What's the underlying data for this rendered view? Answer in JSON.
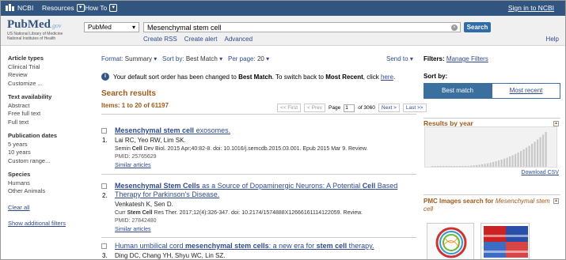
{
  "topbar": {
    "ncbi": "NCBI",
    "resources": "Resources",
    "howto": "How To",
    "signin": "Sign in to NCBI"
  },
  "logo": {
    "text": "PubMed",
    "suffix": ".gov",
    "sub1": "US National Library of Medicine",
    "sub2": "National Institutes of Health"
  },
  "search": {
    "db": "PubMed",
    "query": "Mesenchymal stem cell",
    "button": "Search",
    "links": [
      "Create RSS",
      "Create alert",
      "Advanced"
    ],
    "help": "Help"
  },
  "sidebar": {
    "groups": [
      {
        "title": "Article types",
        "items": [
          "Clinical Trial",
          "Review",
          "Customize ..."
        ]
      },
      {
        "title": "Text availability",
        "items": [
          "Abstract",
          "Free full text",
          "Full text"
        ]
      },
      {
        "title": "Publication dates",
        "items": [
          "5 years",
          "10 years",
          "Custom range..."
        ]
      },
      {
        "title": "Species",
        "items": [
          "Humans",
          "Other Animals"
        ]
      }
    ],
    "clear_all": "Clear all",
    "show_filters": "Show additional filters"
  },
  "toolbar": {
    "format_label": "Format:",
    "format": "Summary",
    "sort_label": "Sort by:",
    "sort": "Best Match",
    "perpage_label": "Per page:",
    "perpage": "20",
    "sendto": "Send to"
  },
  "notice": {
    "pre": "Your default sort order has been changed to",
    "best": "Best Match",
    "mid": ". To switch back to",
    "recent": "Most Recent",
    "post": ", click",
    "link": "here",
    "end": "."
  },
  "results": {
    "title": "Search results",
    "count": "Items: 1 to 20 of 61197",
    "pager": {
      "first": "<< First",
      "prev": "< Prev",
      "page_label": "Page",
      "page": "1",
      "of": "of 3060",
      "next": "Next >",
      "last": "Last >>"
    },
    "items": [
      {
        "num": "1.",
        "title": "Mesenchymal stem cell exosomes.",
        "authors": "Lai RC, Yeo RW, Lim SK.",
        "source": "Semin Cell Dev Biol. 2015 Apr;40:82-8. doi: 10.1016/j.semcdb.2015.03.001. Epub 2015 Mar 9. Review.",
        "pmid": "PMID: 25765629",
        "similar": "Similar articles"
      },
      {
        "num": "2.",
        "title": "Mesenchymal Stem Cells as a Source of Dopaminergic Neurons: A Potential Cell Based Therapy for Parkinson's Disease.",
        "authors": "Venkatesh K, Sen D.",
        "source": "Curr Stem Cell Res Ther. 2017;12(4):326-347. doi: 10.2174/1574888X12666161114122059. Review.",
        "pmid": "PMID: 27842480",
        "similar": "Similar articles"
      },
      {
        "num": "3.",
        "title": "Human umbilical cord mesenchymal stem cells: a new era for stem cell therapy.",
        "authors": "Ding DC, Chang YH, Shyu WC, Lin SZ."
      }
    ]
  },
  "right": {
    "filters_label": "Filters:",
    "filters_link": "Manage Filters",
    "sortby": "Sort by:",
    "best": "Best match",
    "recent": "Most recent",
    "years_title": "Results by year",
    "download": "Download CSV",
    "pmc_title": "PMC Images search for",
    "pmc_query": "Mesenchymal stem cell"
  },
  "colors": {
    "topbar": "#31557f",
    "accent": "#a05a1a",
    "link": "#2f4a8a",
    "button": "#2f6ca8"
  }
}
